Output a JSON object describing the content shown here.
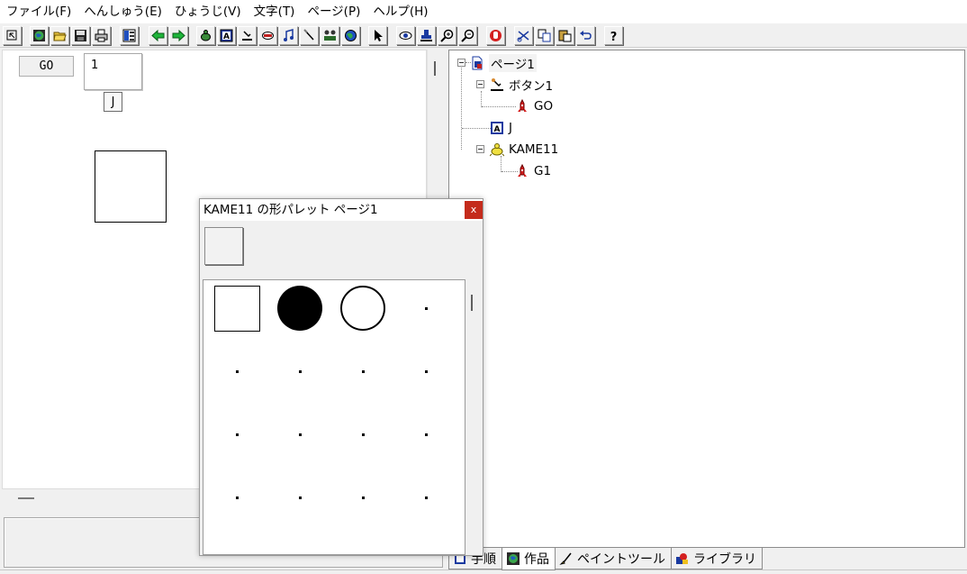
{
  "menu": [
    {
      "id": "file",
      "label": "ファイル(F)"
    },
    {
      "id": "edit",
      "label": "へんしゅう(E)"
    },
    {
      "id": "view",
      "label": "ひょうじ(V)"
    },
    {
      "id": "text",
      "label": "文字(T)"
    },
    {
      "id": "page",
      "label": "ページ(P)"
    },
    {
      "id": "help",
      "label": "ヘルプ(H)"
    }
  ],
  "toolbar": {
    "icons": [
      "pointer-icon",
      "globe-icon",
      "open-folder-icon",
      "save-icon",
      "print-icon",
      "layout-icon",
      "back-arrow-icon",
      "forward-arrow-icon",
      "turtle-icon",
      "text-a-icon",
      "button-icon",
      "field-icon",
      "music-icon",
      "brush-icon",
      "group-icon",
      "world-icon",
      "select-arrow-icon",
      "eye-icon",
      "stamp-icon",
      "zoom-in-icon",
      "zoom-out-icon",
      "stop-hand-icon",
      "cut-icon",
      "copy-icon",
      "paste-icon",
      "undo-icon",
      "help-icon"
    ]
  },
  "stage": {
    "go_button_label": "GO",
    "text_field_value": "1",
    "j_label": "J"
  },
  "palette": {
    "title": "KAME11 の形パレット ページ1",
    "close_label": "x",
    "shapes": [
      "square",
      "filled-circle",
      "ring",
      "dot"
    ]
  },
  "tree": {
    "root": "ページ1",
    "button_node": "ボタン1",
    "button_child": "GO",
    "text_node": "J",
    "turtle_node": "KAME11",
    "turtle_child": "G1"
  },
  "tabs": [
    {
      "id": "procedure",
      "label": "手順"
    },
    {
      "id": "works",
      "label": "作品"
    },
    {
      "id": "paint",
      "label": "ペイントツール"
    },
    {
      "id": "library",
      "label": "ライブラリ"
    }
  ]
}
